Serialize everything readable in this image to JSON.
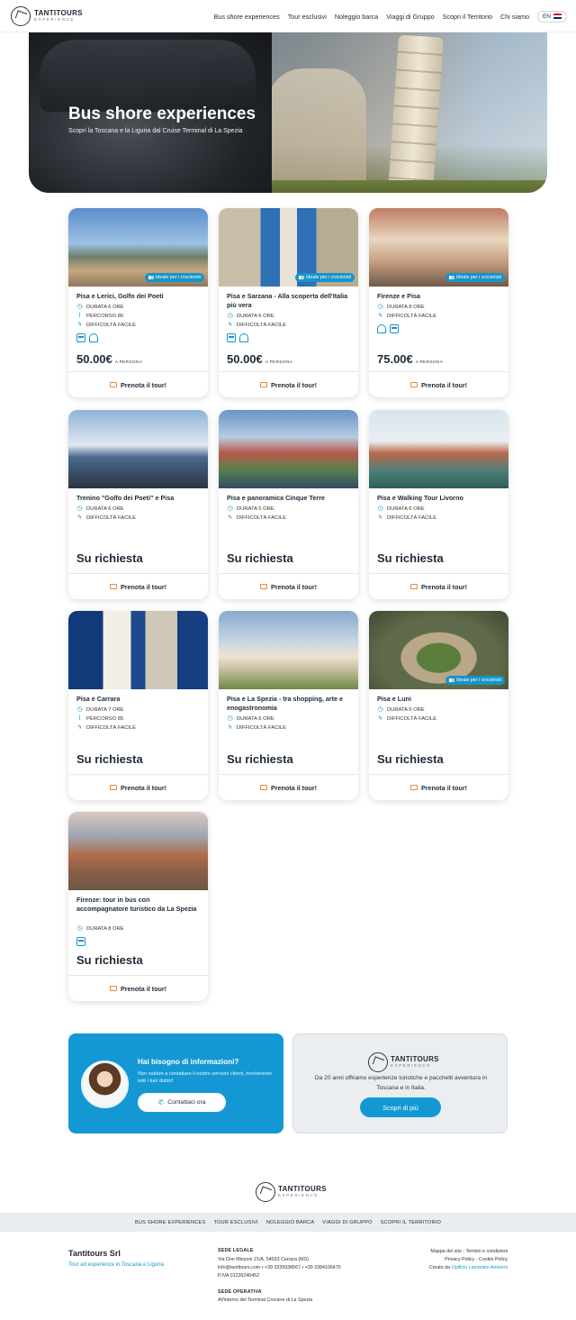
{
  "header": {
    "logo_title": "TANTITOURS",
    "logo_sub": "EXPERIENCE",
    "nav": [
      "Bus shore experiences",
      "Tour esclusivi",
      "Noleggio barca",
      "Viaggi di Gruppo",
      "Scopri il Territorio",
      "Chi siamo"
    ],
    "lang": "EN"
  },
  "hero": {
    "title": "Bus shore experiences",
    "subtitle": "Scopri la Toscana e la Liguria dal Cruise Terminal di La Spezia"
  },
  "badge_label": "Ideale per i crocieristi",
  "book_label": "Prenota il tour!",
  "per_person": "A PERSONA",
  "on_request": "Su richiesta",
  "cards": [
    {
      "title": "Pisa e Lerici, Golfo dei Poeti",
      "features": [
        "DURATA 6 ORE",
        "PERCORSO 80",
        "DIFFICOLTÀ FACILE"
      ],
      "price": "50.00€",
      "badge": true,
      "transport": [
        "bus",
        "tram"
      ]
    },
    {
      "title": "Pisa e Sarzana - Alla scoperta dell'Italia più vera",
      "features": [
        "DURATA 6 ORE",
        "DIFFICOLTÀ FACILE"
      ],
      "price": "50.00€",
      "badge": true,
      "transport": [
        "bus",
        "tram"
      ]
    },
    {
      "title": "Firenze e Pisa",
      "features": [
        "DURATA 8 ORE",
        "DIFFICOLTÀ FACILE"
      ],
      "price": "75.00€",
      "badge": true,
      "transport": [
        "tram",
        "bus"
      ]
    },
    {
      "title": "Trenino \"Golfo dei Poeti\" e Pisa",
      "features": [
        "DURATA 6 ORE",
        "DIFFICOLTÀ FACILE"
      ],
      "price": "",
      "badge": false,
      "transport": []
    },
    {
      "title": "Pisa e panoramica Cinque Terre",
      "features": [
        "DURATA 5 ORE",
        "DIFFICOLTÀ FACILE"
      ],
      "price": "",
      "badge": false,
      "transport": []
    },
    {
      "title": "Pisa e Walking Tour Livorno",
      "features": [
        "DURATA 6 ORE",
        "DIFFICOLTÀ FACILE"
      ],
      "price": "",
      "badge": false,
      "transport": []
    },
    {
      "title": "Pisa e Carrara",
      "features": [
        "DURATA 7 ORE",
        "PERCORSO 85",
        "DIFFICOLTÀ FACILE"
      ],
      "price": "",
      "badge": false,
      "transport": []
    },
    {
      "title": "Pisa e La Spezia - tra shopping, arte e enogastronomia",
      "features": [
        "DURATA 6 ORE",
        "DIFFICOLTÀ FACILE"
      ],
      "price": "",
      "badge": false,
      "transport": []
    },
    {
      "title": "Pisa e Luni",
      "features": [
        "DURATA 5 ORE",
        "DIFFICOLTÀ FACILE"
      ],
      "price": "",
      "badge": true,
      "transport": []
    },
    {
      "title": "Firenze: tour in bus con accompagnatore turistico da La Spezia",
      "features": [
        "DURATA 8 ORE"
      ],
      "price": "",
      "badge": false,
      "transport": [
        "bus"
      ]
    }
  ],
  "info": {
    "title": "Hai bisogno di informazioni?",
    "text": "Non esitare a contattare il nostro servizio clienti, risolveremo tutti i tuoi dubbi!",
    "contact_label": "Contattaci ora",
    "desc": "Da 20 anni offriamo esperienze turistiche e pacchetti avventura in Toscana e in Italia.",
    "more_label": "Scopri di più"
  },
  "footer": {
    "nav": [
      "BUS SHORE EXPERIENCES",
      "TOUR ESCLUSIVI",
      "NOLEGGIO BARCA",
      "VIAGGI DI GRUPPO",
      "SCOPRI IL TERRITORIO"
    ],
    "company": "Tantitours Srl",
    "tagline": "Tour ed esperienze in Toscana e Liguria",
    "legal_head": "SEDE LEGALE",
    "legal_lines": [
      "Via Don Minzoni 21/A, 54033 Carrara (MS)",
      "info@tantitours.com • +39 3339938567 • +39 3384106470",
      "P.IVA 01235240452"
    ],
    "op_head": "SEDE OPERATIVA",
    "op_line": "All'interno del Terminal Crociere di La Spezia",
    "right_lines": [
      "Mappa del sito - Termini e condizioni",
      "Privacy Policy - Cookie Policy"
    ],
    "credit_prefix": "Creato da",
    "credit_link": "Opificio Lamantini Anonimi"
  }
}
